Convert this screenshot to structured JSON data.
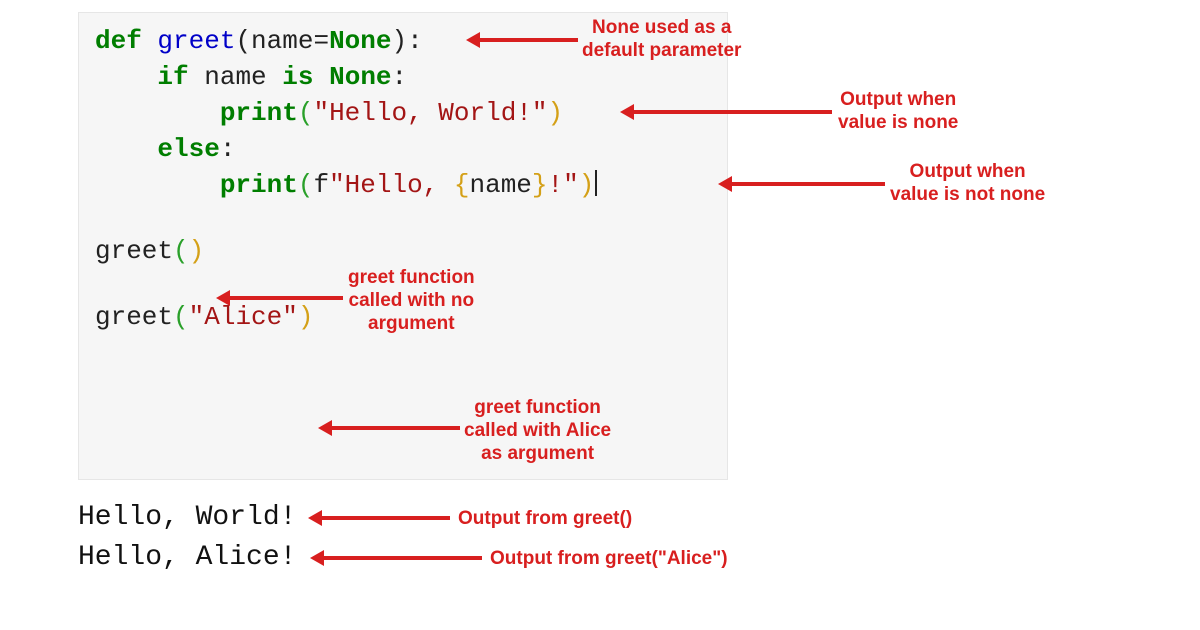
{
  "code": {
    "line1": {
      "def": "def",
      "fname": "greet",
      "open": "(",
      "param": "name",
      "eq": "=",
      "none": "None",
      "close": ")",
      "colon": ":"
    },
    "line2": {
      "indent": "    ",
      "kif": "if",
      "sp": " ",
      "name": "name",
      "sp2": " ",
      "kis": "is",
      "sp3": " ",
      "none": "None",
      "colon": ":"
    },
    "line3": {
      "indent": "        ",
      "print": "print",
      "open": "(",
      "q1": "\"",
      "str": "Hello, World!",
      "q2": "\"",
      "close": ")"
    },
    "line4": {
      "indent": "    ",
      "elsekw": "else",
      "colon": ":"
    },
    "line5": {
      "indent": "        ",
      "print": "print",
      "open": "(",
      "f": "f",
      "q1": "\"",
      "lit1": "Hello, ",
      "lbrace": "{",
      "name": "name",
      "rbrace": "}",
      "lit2": "!",
      "q2": "\"",
      "close": ")"
    },
    "line6": {
      "call": "greet",
      "open": "(",
      "close": ")"
    },
    "line7": {
      "call": "greet",
      "open": "(",
      "q1": "\"",
      "arg": "Alice",
      "q2": "\"",
      "close": ")"
    }
  },
  "output": {
    "line1": "Hello, World!",
    "line2": "Hello, Alice!"
  },
  "annotations": {
    "a1_l1": "None used as a",
    "a1_l2": "default parameter",
    "a2_l1": "Output when",
    "a2_l2": "value is none",
    "a3_l1": "Output when",
    "a3_l2": "value is not none",
    "a4_l1": "greet function",
    "a4_l2": "called with no",
    "a4_l3": "argument",
    "a5_l1": "greet function",
    "a5_l2": "called with Alice",
    "a5_l3": "as argument",
    "a6": "Output from greet()",
    "a7": "Output from greet(\"Alice\")"
  },
  "colors": {
    "annotation": "#d81f1f",
    "keyword": "#007e00",
    "function": "#0000c8",
    "string": "#a31515",
    "code_bg": "#f6f6f6"
  }
}
